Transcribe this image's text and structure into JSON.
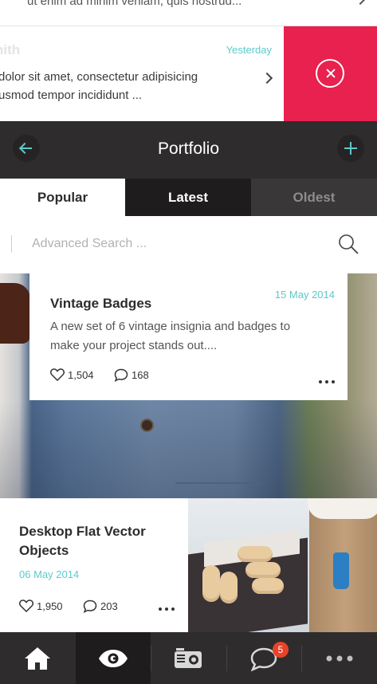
{
  "previous_item": {
    "text": "ut enim ad minim veniam, quis nostrud..."
  },
  "swipe_item": {
    "sender": "nith",
    "date": "Yesterday",
    "line1": "dolor sit amet, consectetur adipisicing",
    "line2": "usmod tempor incididunt ..."
  },
  "header": {
    "title": "Portfolio"
  },
  "tabs": [
    {
      "label": "Popular",
      "state": "default"
    },
    {
      "label": "Latest",
      "state": "selected"
    },
    {
      "label": "Oldest",
      "state": "default"
    }
  ],
  "search": {
    "placeholder": "Advanced Search ...",
    "value": ""
  },
  "items": [
    {
      "title": "Vintage Badges",
      "date": "15 May 2014",
      "description": "A new set of 6 vintage insignia and badges to make your project stands out....",
      "likes": "1,504",
      "comments": "168"
    },
    {
      "title": "Desktop Flat Vector Objects",
      "date": "06 May 2014",
      "likes": "1,950",
      "comments": "203"
    }
  ],
  "bottom_nav": {
    "items": [
      {
        "icon": "home-icon"
      },
      {
        "icon": "eye-icon",
        "active": true
      },
      {
        "icon": "radio-icon"
      },
      {
        "icon": "chat-icon",
        "badge": "5"
      },
      {
        "icon": "more-icon"
      }
    ]
  },
  "colors": {
    "accent": "#5ec9c9",
    "delete": "#e8214f",
    "header_bg": "#2f2c2d",
    "badge": "#e8432a"
  }
}
